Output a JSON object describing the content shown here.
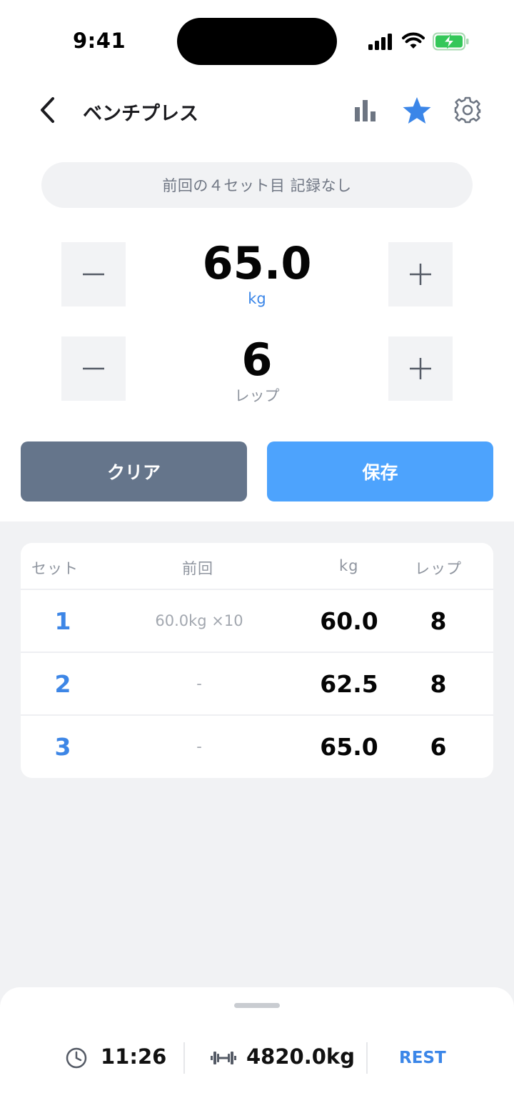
{
  "status_bar": {
    "time": "9:41"
  },
  "header": {
    "title": "ベンチプレス"
  },
  "banner": {
    "text": "前回の４セット目 記録なし"
  },
  "weight": {
    "value": "65.0",
    "unit": "kg"
  },
  "reps": {
    "value": "6",
    "unit": "レップ"
  },
  "actions": {
    "clear_label": "クリア",
    "save_label": "保存"
  },
  "table": {
    "headers": {
      "set": "セット",
      "previous": "前回",
      "kg": "kg",
      "reps": "レップ"
    },
    "rows": [
      {
        "set": "1",
        "previous": "60.0kg ×10",
        "kg": "60.0",
        "reps": "8"
      },
      {
        "set": "2",
        "previous": "-",
        "kg": "62.5",
        "reps": "8"
      },
      {
        "set": "3",
        "previous": "-",
        "kg": "65.0",
        "reps": "6"
      }
    ]
  },
  "footer": {
    "elapsed": "11:26",
    "volume": "4820.0kg",
    "rest_label": "REST"
  },
  "colors": {
    "accent": "#3d86e6",
    "save_button": "#4da3fd",
    "clear_button": "#65758b",
    "battery_green": "#34c759"
  },
  "icons": [
    "chevron-left-icon",
    "bar-chart-icon",
    "star-icon",
    "gear-icon",
    "minus-icon",
    "plus-icon",
    "clock-icon",
    "dumbbell-icon"
  ]
}
